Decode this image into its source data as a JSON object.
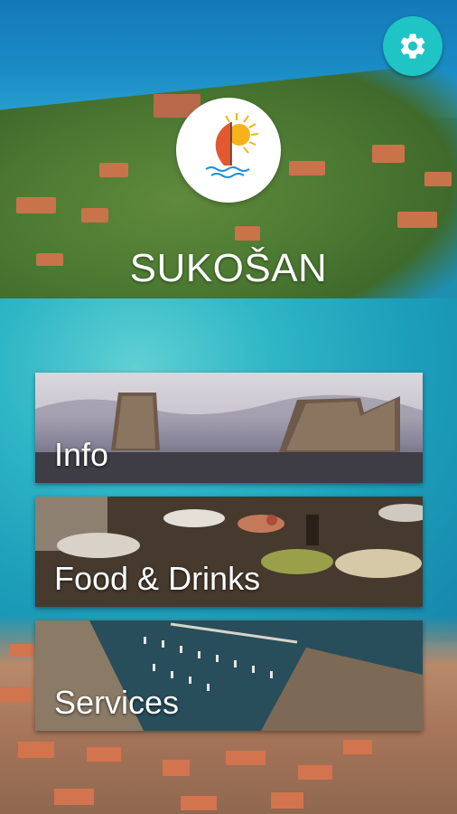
{
  "header": {
    "app_title": "SUKOŠAN",
    "settings_icon": "gear-icon",
    "logo_icon": "sailboat-sun-logo"
  },
  "menu": {
    "items": [
      {
        "label": "Info",
        "image": "stone-tower-ruins"
      },
      {
        "label": "Food & Drinks",
        "image": "food-table"
      },
      {
        "label": "Services",
        "image": "marina-aerial"
      }
    ]
  },
  "colors": {
    "accent": "#1ec5c4",
    "title_text": "#ffffff",
    "logo_sail": "#e2592f",
    "logo_sun": "#f7b21b"
  }
}
